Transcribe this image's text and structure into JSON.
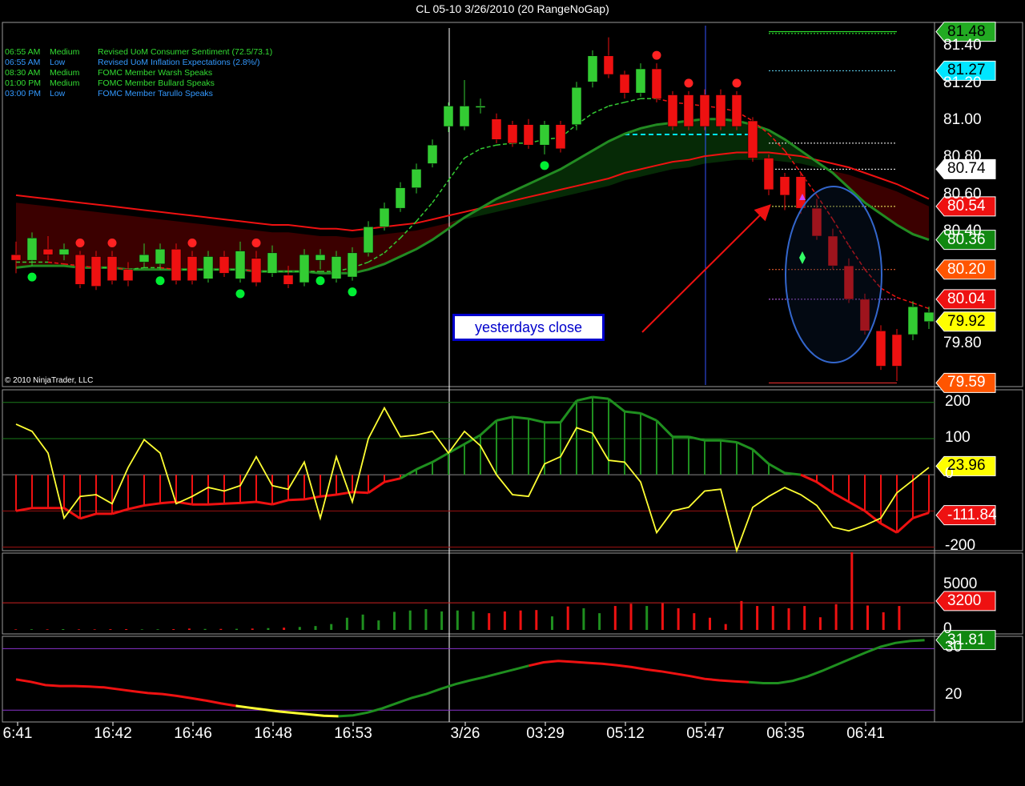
{
  "title": "CL 05-10  3/26/2010 (20 RangeNoGap)",
  "copyright": "© 2010 NinjaTrader, LLC",
  "annotation": "yesterdays close",
  "news": [
    {
      "time": "06:55 AM",
      "level": "Medium",
      "event": "Revised UoM Consumer Sentiment (72.5/73.1)",
      "color": "#33dd33"
    },
    {
      "time": "06:55 AM",
      "level": "Low",
      "event": "Revised UoM Inflation Expectations (2.8%/)",
      "color": "#3399ff"
    },
    {
      "time": "08:30 AM",
      "level": "Medium",
      "event": "FOMC Member Warsh Speaks",
      "color": "#33dd33"
    },
    {
      "time": "01:00 PM",
      "level": "Medium",
      "event": "FOMC Member Bullard Speaks",
      "color": "#33dd33"
    },
    {
      "time": "03:00 PM",
      "level": "Low",
      "event": "FOMC Member Tarullo Speaks",
      "color": "#3399ff"
    }
  ],
  "colors": {
    "up": "#33cc33",
    "down": "#ee1111",
    "background": "#000000"
  },
  "chart_data": [
    {
      "type": "candlestick",
      "panel": "price",
      "x_labels": [
        "6:41",
        "16:42",
        "16:46",
        "16:48",
        "16:53",
        "3/26",
        "03:29",
        "05:12",
        "05:47",
        "06:35",
        "06:41"
      ],
      "x_label_index": [
        0,
        6,
        11,
        16,
        21,
        28,
        33,
        38,
        43,
        48,
        53
      ],
      "y_tick_labels": [
        "81.40",
        "81.20",
        "81.00",
        "80.80",
        "80.60",
        "80.40",
        "79.80"
      ],
      "y_ticks": [
        81.4,
        81.2,
        81.0,
        80.8,
        80.6,
        80.4,
        79.8
      ],
      "ylim": [
        79.57,
        81.53
      ],
      "price_tags": [
        {
          "text": "81.48",
          "value": 81.48,
          "bg": "#22aa22",
          "fg": "#000000"
        },
        {
          "text": "81.27",
          "value": 81.27,
          "bg": "#00e5ff",
          "fg": "#000000"
        },
        {
          "text": "80.74",
          "value": 80.74,
          "bg": "#ffffff",
          "fg": "#000000"
        },
        {
          "text": "80.54",
          "value": 80.54,
          "bg": "#ee1111",
          "fg": "#ffffff"
        },
        {
          "text": "80.36",
          "value": 80.36,
          "bg": "#118811",
          "fg": "#ffffff"
        },
        {
          "text": "80.20",
          "value": 80.2,
          "bg": "#ff5500",
          "fg": "#ffffff"
        },
        {
          "text": "80.04",
          "value": 80.04,
          "bg": "#ee1111",
          "fg": "#ffffff"
        },
        {
          "text": "79.92",
          "value": 79.92,
          "bg": "#ffff00",
          "fg": "#000000"
        },
        {
          "text": "79.59",
          "value": 79.59,
          "bg": "#ff5500",
          "fg": "#ffffff"
        }
      ],
      "candles": [
        {
          "o": 80.28,
          "c": 80.25,
          "h": 80.35,
          "l": 80.18
        },
        {
          "o": 80.25,
          "c": 80.37,
          "h": 80.4,
          "l": 80.22
        },
        {
          "o": 80.31,
          "c": 80.28,
          "h": 80.38,
          "l": 80.25
        },
        {
          "o": 80.28,
          "c": 80.31,
          "h": 80.34,
          "l": 80.25
        },
        {
          "o": 80.28,
          "c": 80.12,
          "h": 80.3,
          "l": 80.1
        },
        {
          "o": 80.27,
          "c": 80.11,
          "h": 80.3,
          "l": 80.09
        },
        {
          "o": 80.27,
          "c": 80.14,
          "h": 80.3,
          "l": 80.12
        },
        {
          "o": 80.2,
          "c": 80.14,
          "h": 80.24,
          "l": 80.11
        },
        {
          "o": 80.24,
          "c": 80.28,
          "h": 80.34,
          "l": 80.21
        },
        {
          "o": 80.23,
          "c": 80.31,
          "h": 80.34,
          "l": 80.2
        },
        {
          "o": 80.31,
          "c": 80.14,
          "h": 80.34,
          "l": 80.12
        },
        {
          "o": 80.27,
          "c": 80.14,
          "h": 80.3,
          "l": 80.12
        },
        {
          "o": 80.15,
          "c": 80.27,
          "h": 80.3,
          "l": 80.13
        },
        {
          "o": 80.27,
          "c": 80.18,
          "h": 80.3,
          "l": 80.16
        },
        {
          "o": 80.15,
          "c": 80.3,
          "h": 80.35,
          "l": 80.13
        },
        {
          "o": 80.26,
          "c": 80.13,
          "h": 80.3,
          "l": 80.11
        },
        {
          "o": 80.18,
          "c": 80.29,
          "h": 80.33,
          "l": 80.16
        },
        {
          "o": 80.17,
          "c": 80.12,
          "h": 80.22,
          "l": 80.1
        },
        {
          "o": 80.13,
          "c": 80.28,
          "h": 80.31,
          "l": 80.11
        },
        {
          "o": 80.25,
          "c": 80.28,
          "h": 80.31,
          "l": 80.2
        },
        {
          "o": 80.15,
          "c": 80.27,
          "h": 80.3,
          "l": 80.13
        },
        {
          "o": 80.16,
          "c": 80.29,
          "h": 80.32,
          "l": 80.14
        },
        {
          "o": 80.29,
          "c": 80.43,
          "h": 80.46,
          "l": 80.27
        },
        {
          "o": 80.43,
          "c": 80.53,
          "h": 80.56,
          "l": 80.41
        },
        {
          "o": 80.53,
          "c": 80.64,
          "h": 80.67,
          "l": 80.51
        },
        {
          "o": 80.64,
          "c": 80.74,
          "h": 80.77,
          "l": 80.61
        },
        {
          "o": 80.77,
          "c": 80.87,
          "h": 80.9,
          "l": 80.75
        },
        {
          "o": 80.97,
          "c": 81.08,
          "h": 81.1,
          "l": 80.94
        },
        {
          "o": 80.97,
          "c": 81.08,
          "h": 81.22,
          "l": 80.95
        },
        {
          "o": 81.08,
          "c": 81.08,
          "h": 81.12,
          "l": 81.04
        },
        {
          "o": 81.01,
          "c": 80.9,
          "h": 81.04,
          "l": 80.88
        },
        {
          "o": 80.98,
          "c": 80.88,
          "h": 81.0,
          "l": 80.86
        },
        {
          "o": 80.98,
          "c": 80.87,
          "h": 81.01,
          "l": 80.85
        },
        {
          "o": 80.87,
          "c": 80.98,
          "h": 81.0,
          "l": 80.82
        },
        {
          "o": 80.98,
          "c": 80.85,
          "h": 81.0,
          "l": 80.83
        },
        {
          "o": 80.98,
          "c": 81.18,
          "h": 81.21,
          "l": 80.95
        },
        {
          "o": 81.21,
          "c": 81.35,
          "h": 81.38,
          "l": 81.18
        },
        {
          "o": 81.35,
          "c": 81.25,
          "h": 81.45,
          "l": 81.23
        },
        {
          "o": 81.25,
          "c": 81.15,
          "h": 81.27,
          "l": 81.12
        },
        {
          "o": 81.15,
          "c": 81.28,
          "h": 81.31,
          "l": 81.13
        },
        {
          "o": 81.28,
          "c": 81.12,
          "h": 81.31,
          "l": 81.1
        },
        {
          "o": 81.14,
          "c": 80.97,
          "h": 81.16,
          "l": 80.95
        },
        {
          "o": 81.14,
          "c": 80.97,
          "h": 81.16,
          "l": 80.95
        },
        {
          "o": 81.14,
          "c": 80.97,
          "h": 81.17,
          "l": 80.95
        },
        {
          "o": 81.14,
          "c": 80.97,
          "h": 81.17,
          "l": 80.95
        },
        {
          "o": 81.14,
          "c": 80.97,
          "h": 81.16,
          "l": 80.95
        },
        {
          "o": 81.0,
          "c": 80.8,
          "h": 81.02,
          "l": 80.78
        },
        {
          "o": 80.8,
          "c": 80.63,
          "h": 80.82,
          "l": 80.6
        },
        {
          "o": 80.7,
          "c": 80.6,
          "h": 80.72,
          "l": 80.52
        },
        {
          "o": 80.7,
          "c": 80.53,
          "h": 80.72,
          "l": 80.5
        },
        {
          "o": 80.53,
          "c": 80.38,
          "h": 80.58,
          "l": 80.36
        },
        {
          "o": 80.38,
          "c": 80.22,
          "h": 80.42,
          "l": 80.2
        },
        {
          "o": 80.22,
          "c": 80.04,
          "h": 80.26,
          "l": 80.02
        },
        {
          "o": 80.04,
          "c": 79.87,
          "h": 80.07,
          "l": 79.85
        },
        {
          "o": 79.87,
          "c": 79.68,
          "h": 79.9,
          "l": 79.66
        },
        {
          "o": 79.85,
          "c": 79.68,
          "h": 79.88,
          "l": 79.6
        },
        {
          "o": 79.85,
          "c": 80.0,
          "h": 80.03,
          "l": 79.82
        },
        {
          "o": 79.92,
          "c": 79.97,
          "h": 80.0,
          "l": 79.88
        }
      ],
      "bullish_markers": [
        1,
        9,
        14,
        19,
        21,
        33
      ],
      "bearish_markers": [
        4,
        6,
        11,
        15,
        40,
        42,
        45
      ],
      "ema_fast": [
        80.24,
        80.24,
        80.24,
        80.23,
        80.22,
        80.21,
        80.21,
        80.2,
        80.21,
        80.21,
        80.2,
        80.2,
        80.2,
        80.2,
        80.2,
        80.19,
        80.19,
        80.19,
        80.19,
        80.19,
        80.19,
        80.21,
        80.24,
        80.29,
        80.37,
        80.46,
        80.56,
        80.68,
        80.8,
        80.85,
        80.87,
        80.88,
        80.88,
        80.9,
        80.91,
        80.98,
        81.04,
        81.08,
        81.1,
        81.12,
        81.12,
        81.1,
        81.09,
        81.08,
        81.07,
        81.05,
        81.0,
        80.93,
        80.84,
        80.72,
        80.6,
        80.47,
        80.33,
        80.2,
        80.1,
        80.05,
        80.02,
        79.99
      ],
      "ema_mid": [
        80.21,
        80.22,
        80.22,
        80.22,
        80.21,
        80.21,
        80.21,
        80.2,
        80.2,
        80.2,
        80.2,
        80.2,
        80.2,
        80.2,
        80.2,
        80.19,
        80.19,
        80.19,
        80.19,
        80.18,
        80.18,
        80.18,
        80.2,
        80.23,
        80.27,
        80.31,
        80.36,
        80.42,
        80.48,
        80.53,
        80.58,
        80.62,
        80.66,
        80.7,
        80.74,
        80.79,
        80.84,
        80.89,
        80.93,
        80.96,
        80.98,
        80.99,
        81.0,
        81.01,
        81.01,
        81.0,
        80.98,
        80.95,
        80.9,
        80.84,
        80.78,
        80.72,
        80.64,
        80.56,
        80.5,
        80.44,
        80.39,
        80.36
      ],
      "ema_slow": [
        80.56,
        80.55,
        80.54,
        80.53,
        80.52,
        80.51,
        80.5,
        80.49,
        80.48,
        80.47,
        80.46,
        80.45,
        80.44,
        80.43,
        80.42,
        80.41,
        80.4,
        80.4,
        80.39,
        80.38,
        80.38,
        80.37,
        80.38,
        80.39,
        80.4,
        80.41,
        80.43,
        80.45,
        80.47,
        80.49,
        80.51,
        80.53,
        80.55,
        80.57,
        80.59,
        80.61,
        80.63,
        80.65,
        80.68,
        80.7,
        80.72,
        80.74,
        80.75,
        80.77,
        80.78,
        80.79,
        80.79,
        80.79,
        80.78,
        80.77,
        80.75,
        80.73,
        80.71,
        80.68,
        80.65,
        80.62,
        80.58,
        80.54
      ],
      "ema_slow_upper": [
        80.6,
        80.59,
        80.58,
        80.57,
        80.56,
        80.55,
        80.54,
        80.53,
        80.52,
        80.51,
        80.5,
        80.49,
        80.48,
        80.47,
        80.46,
        80.45,
        80.44,
        80.44,
        80.43,
        80.42,
        80.42,
        80.41,
        80.42,
        80.43,
        80.44,
        80.45,
        80.47,
        80.49,
        80.51,
        80.53,
        80.55,
        80.57,
        80.59,
        80.61,
        80.63,
        80.65,
        80.67,
        80.69,
        80.72,
        80.74,
        80.76,
        80.78,
        80.79,
        80.81,
        80.82,
        80.83,
        80.83,
        80.83,
        80.82,
        80.81,
        80.79,
        80.77,
        80.75,
        80.72,
        80.69,
        80.66,
        80.62,
        80.58
      ],
      "support_resistance": [
        81.48,
        81.47,
        81.27,
        80.88,
        80.74,
        80.54,
        80.2,
        80.04,
        79.59
      ],
      "cyan_level": 81.0,
      "vertical_cursor_index": 28,
      "blue_vertical_index": 45
    },
    {
      "type": "bar+line",
      "panel": "oscillator",
      "y_tick_labels": [
        "200",
        "100",
        "0",
        "-200"
      ],
      "y_ticks": [
        200,
        100,
        0,
        -200
      ],
      "ylim": [
        -210,
        235
      ],
      "tags": [
        {
          "text": "23.96",
          "value": 23.96,
          "bg": "#ffff00",
          "fg": "#000000"
        },
        {
          "text": "-111.84",
          "value": -111.84,
          "bg": "#ee1111",
          "fg": "#ffffff"
        }
      ],
      "histogram": [
        -100,
        -92,
        -92,
        -92,
        -121,
        -108,
        -108,
        -95,
        -85,
        -79,
        -75,
        -82,
        -82,
        -80,
        -78,
        -75,
        -82,
        -70,
        -68,
        -60,
        -55,
        -48,
        -50,
        -20,
        -10,
        15,
        35,
        60,
        85,
        110,
        150,
        160,
        155,
        145,
        145,
        205,
        215,
        210,
        175,
        170,
        150,
        105,
        105,
        95,
        95,
        90,
        70,
        30,
        5,
        0,
        -20,
        -50,
        -75,
        -100,
        -135,
        -160,
        -120,
        -105
      ],
      "histogram_line": [
        -100,
        -92,
        -92,
        -92,
        -121,
        -108,
        -108,
        -95,
        -85,
        -79,
        -75,
        -82,
        -82,
        -80,
        -78,
        -75,
        -82,
        -70,
        -68,
        -60,
        -55,
        -48,
        -50,
        -20,
        -10,
        15,
        35,
        60,
        85,
        110,
        150,
        160,
        155,
        145,
        145,
        205,
        215,
        210,
        175,
        170,
        150,
        105,
        105,
        95,
        95,
        90,
        70,
        30,
        5,
        0,
        -20,
        -50,
        -75,
        -100,
        -135,
        -160,
        -120,
        -105
      ],
      "cci": [
        140,
        120,
        60,
        -120,
        -60,
        -55,
        -80,
        20,
        97,
        60,
        -80,
        -60,
        -35,
        -45,
        -30,
        50,
        -30,
        -40,
        35,
        -120,
        50,
        -75,
        100,
        185,
        105,
        110,
        120,
        60,
        120,
        80,
        0,
        -55,
        -60,
        30,
        50,
        130,
        115,
        40,
        35,
        -20,
        -160,
        -100,
        -90,
        -45,
        -40,
        -210,
        -90,
        -60,
        -35,
        -55,
        -85,
        -145,
        -155,
        -140,
        -120,
        -50,
        -15,
        20
      ]
    },
    {
      "type": "bar",
      "panel": "volume",
      "y_tick_labels": [
        "5000",
        "0"
      ],
      "y_ticks": [
        5000,
        0
      ],
      "ylim": [
        0,
        8500
      ],
      "tags": [
        {
          "text": "3200",
          "value": 3200,
          "bg": "#ee1111",
          "fg": "#ffffff"
        }
      ],
      "reference_line": 3000,
      "values": [
        60,
        60,
        70,
        60,
        90,
        60,
        60,
        80,
        90,
        60,
        70,
        90,
        150,
        110,
        110,
        120,
        150,
        200,
        250,
        330,
        430,
        650,
        1350,
        1700,
        1050,
        2000,
        2150,
        2300,
        2050,
        2150,
        2050,
        1850,
        2050,
        2150,
        2200,
        1500,
        2600,
        2400,
        1850,
        2650,
        2900,
        2650,
        2950,
        2400,
        1850,
        1350,
        650,
        3200,
        2650,
        2650,
        2400,
        2650,
        1400,
        2850,
        8600,
        2700,
        1950,
        2650,
        2650,
        2500,
        2750,
        3450,
        3200
      ]
    },
    {
      "type": "line",
      "panel": "adx",
      "y_tick_labels": [
        "30",
        "20"
      ],
      "y_ticks": [
        30,
        20
      ],
      "ylim": [
        14.5,
        32.6
      ],
      "tags": [
        {
          "text": "31.81",
          "value": 31.81,
          "bg": "#118811",
          "fg": "#ffffff"
        }
      ],
      "reference_lines": [
        30.0,
        17.0
      ],
      "values": [
        23.5,
        23.0,
        22.3,
        22.1,
        22.1,
        22.0,
        21.8,
        21.4,
        21.0,
        20.6,
        20.4,
        20.0,
        19.5,
        19.0,
        18.4,
        17.9,
        17.5,
        17.1,
        16.7,
        16.4,
        16.1,
        15.8,
        15.7,
        15.9,
        16.5,
        17.4,
        18.5,
        19.6,
        20.4,
        21.5,
        22.5,
        23.3,
        24.0,
        24.8,
        25.6,
        26.4,
        27.1,
        27.4,
        27.2,
        27.0,
        26.8,
        26.5,
        26.1,
        25.6,
        25.2,
        24.7,
        24.2,
        23.6,
        23.3,
        23.1,
        22.9,
        22.7,
        22.7,
        23.2,
        24.1,
        25.3,
        26.6,
        27.9,
        29.2,
        30.4,
        31.2,
        31.6,
        31.8
      ],
      "segment_colors": [
        {
          "from": 0,
          "to": 15,
          "color": "red"
        },
        {
          "from": 15,
          "to": 22,
          "color": "yellow"
        },
        {
          "from": 22,
          "to": 35,
          "color": "green"
        },
        {
          "from": 35,
          "to": 50,
          "color": "red"
        },
        {
          "from": 50,
          "to": 62,
          "color": "green"
        }
      ]
    }
  ]
}
